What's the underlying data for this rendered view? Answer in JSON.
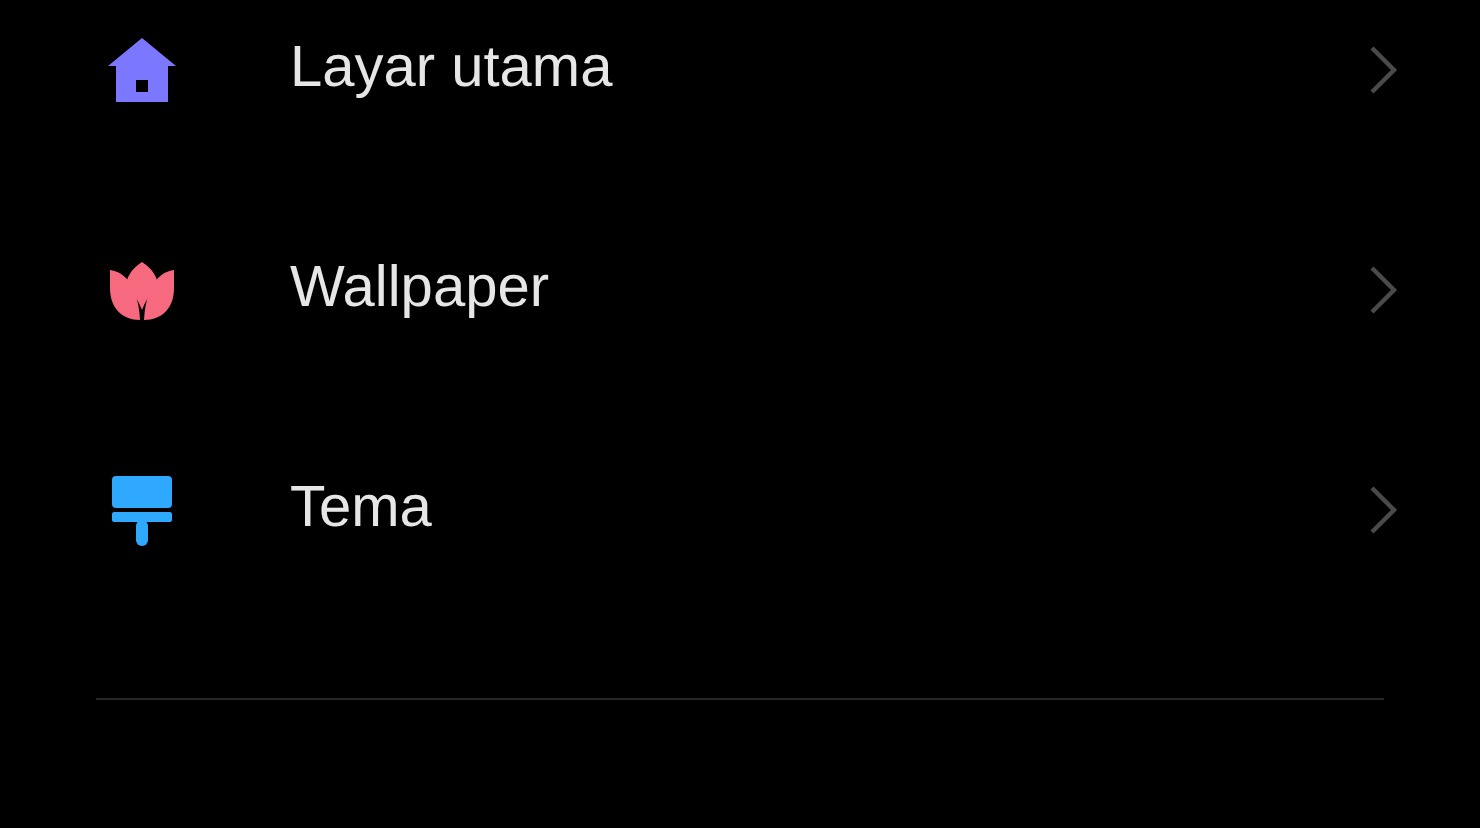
{
  "menu_items": [
    {
      "kind": "home",
      "color": "#7b78ff",
      "label": "Layar utama"
    },
    {
      "kind": "flower",
      "color": "#f7697f",
      "label": "Wallpaper"
    },
    {
      "kind": "brush",
      "color": "#2fa8ff",
      "label": "Tema"
    }
  ]
}
